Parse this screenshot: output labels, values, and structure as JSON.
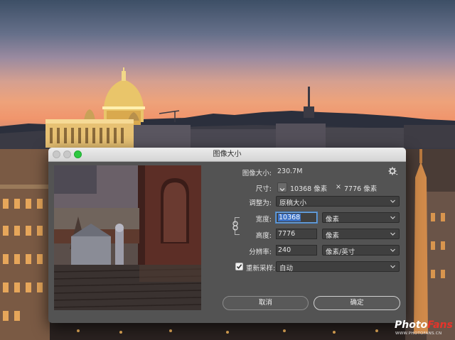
{
  "dialog": {
    "title": "图像大小",
    "image_size_label": "图像大小:",
    "image_size_value": "230.7M",
    "dimensions_label": "尺寸:",
    "dimensions_width": "10368 像素",
    "dimensions_sep": "×",
    "dimensions_height": "7776 像素",
    "fit_to_label": "调整为:",
    "fit_to_value": "原稿大小",
    "width_label": "宽度:",
    "width_value": "10368",
    "width_unit": "像素",
    "height_label": "高度:",
    "height_value": "7776",
    "height_unit": "像素",
    "resolution_label": "分辨率:",
    "resolution_value": "240",
    "resolution_unit": "像素/英寸",
    "resample_label": "重新采样:",
    "resample_checked": true,
    "resample_value": "自动",
    "cancel_label": "取消",
    "ok_label": "确定",
    "icons": [
      "gear-icon",
      "chevron-down-icon",
      "link-icon",
      "checkmark-icon"
    ]
  },
  "watermark": {
    "brand_part1": "Photo",
    "brand_part2": "Fans",
    "url": "WWW.PHOTOFANS.CN"
  },
  "colors": {
    "dialog_bg": "#535353",
    "input_focus": "#3a70c4",
    "brand_red": "#e8332a",
    "traffic_green": "#2dc840"
  }
}
